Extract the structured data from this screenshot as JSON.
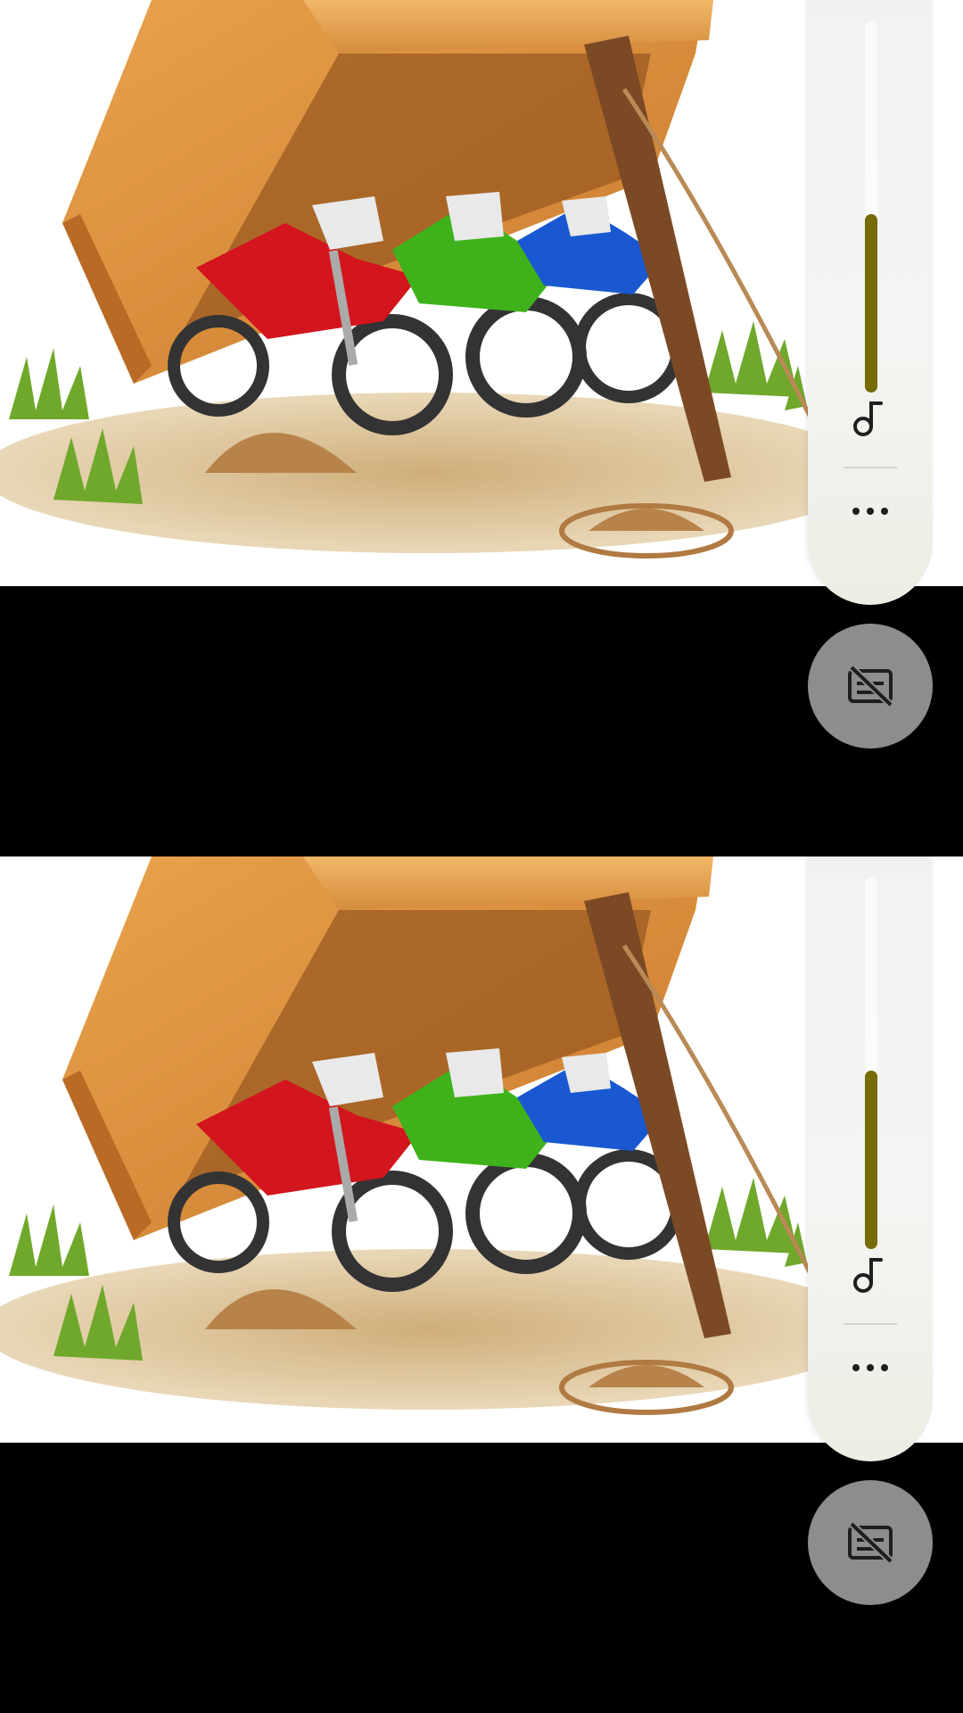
{
  "volume_panels": [
    {
      "level": 0.48,
      "accent_color": "#766b04",
      "music_icon": "music-note-icon",
      "more_icon": "more-horizontal-icon",
      "caption_icon": "captions-off-icon"
    },
    {
      "level": 0.48,
      "accent_color": "#766b04",
      "music_icon": "music-note-icon",
      "more_icon": "more-horizontal-icon",
      "caption_icon": "captions-off-icon"
    }
  ],
  "video_frame": {
    "subject": "three-dirt-bikes-under-wooden-crate-icon",
    "bike_colors": [
      "#d3151d",
      "#3fb21b",
      "#1a58d1"
    ],
    "background_color": "#ffffff"
  }
}
